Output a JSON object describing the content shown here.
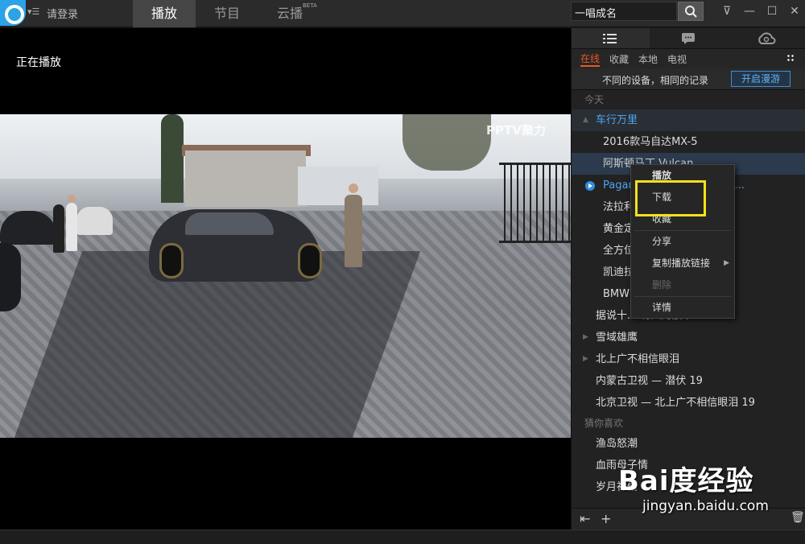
{
  "topbar": {
    "login_label": "请登录",
    "tabs": [
      {
        "label": "播放"
      },
      {
        "label": "节目"
      },
      {
        "label": "云播",
        "sup": "BETA"
      }
    ],
    "search_value": "一唱成名"
  },
  "player": {
    "now_playing": "正在播放",
    "watermark": "PPTV聚力"
  },
  "sidebar": {
    "subtabs": [
      "在线",
      "收藏",
      "本地",
      "电视"
    ],
    "sync_text": "不同的设备，相同的记录",
    "sync_button": "开启漫游",
    "section_today": "今天",
    "section_guess": "猜你喜欢",
    "rows": [
      {
        "text": "车行万里"
      },
      {
        "text": "2016款马自达MX-5"
      },
      {
        "text": "阿斯顿马丁 Vulcan"
      },
      {
        "text": "Pagani Huayra 二全碳纤维..."
      },
      {
        "text": "法拉利 ... 内罗发布会..."
      },
      {
        "text": "黄金定 ... tador"
      },
      {
        "text": "全方位 ... es C63 AM..."
      },
      {
        "text": "凯迪拉克"
      },
      {
        "text": "BMW ... 球限量23部"
      },
      {
        "text": "据说十... 有八对放下..."
      },
      {
        "text": "雪域雄鹰"
      },
      {
        "text": "北上广不相信眼泪"
      },
      {
        "text": "内蒙古卫视 — 潜伏 19"
      },
      {
        "text": "北京卫视 — 北上广不相信眼泪 19"
      }
    ],
    "guess_rows": [
      {
        "text": "渔岛怒潮"
      },
      {
        "text": "血雨母子情"
      },
      {
        "text": "岁月神偷"
      }
    ]
  },
  "context_menu": {
    "items": [
      "播放",
      "下载",
      "收藏",
      "分享",
      "复制播放链接",
      "删除",
      "详情"
    ]
  },
  "watermark_baidu": {
    "main": "Bai度经验",
    "sub": "jingyan.baidu.com"
  },
  "colors": {
    "accent_orange": "#e85a22",
    "accent_blue": "#4ea5f0",
    "highlight_yellow": "#f5e11a"
  }
}
